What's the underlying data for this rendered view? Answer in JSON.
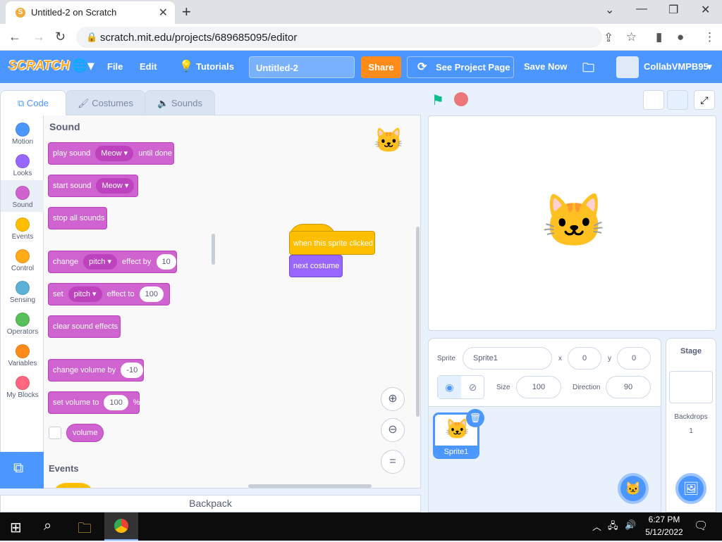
{
  "browser": {
    "tab_title": "Untitled-2 on Scratch",
    "url": "scratch.mit.edu/projects/689685095/editor"
  },
  "menu": {
    "logo": "SCRATCH",
    "file": "File",
    "edit": "Edit",
    "tutorials": "Tutorials",
    "project_title": "Untitled-2",
    "share": "Share",
    "see_project": "See Project Page",
    "save_now": "Save Now",
    "username": "CollabVMPB95"
  },
  "tabs": {
    "code": "Code",
    "costumes": "Costumes",
    "sounds": "Sounds"
  },
  "categories": [
    {
      "label": "Motion",
      "color": "#4c97ff"
    },
    {
      "label": "Looks",
      "color": "#9966ff"
    },
    {
      "label": "Sound",
      "color": "#cf63cf"
    },
    {
      "label": "Events",
      "color": "#ffbf00"
    },
    {
      "label": "Control",
      "color": "#ffab19"
    },
    {
      "label": "Sensing",
      "color": "#5cb1d6"
    },
    {
      "label": "Operators",
      "color": "#59c059"
    },
    {
      "label": "Variables",
      "color": "#ff8c1a"
    },
    {
      "label": "My Blocks",
      "color": "#ff6680"
    }
  ],
  "palette": {
    "section_sound": "Sound",
    "play_sound": "play sound",
    "meow": "Meow",
    "until_done": "until done",
    "start_sound": "start sound",
    "stop_all_sounds": "stop all sounds",
    "change": "change",
    "pitch": "pitch",
    "effect_by": "effect by",
    "val_10": "10",
    "set": "set",
    "effect_to": "effect to",
    "val_100": "100",
    "clear_sound_effects": "clear sound effects",
    "change_volume_by": "change volume by",
    "val_neg10": "-10",
    "set_volume_to": "set volume to",
    "percent": "%",
    "volume": "volume",
    "section_events": "Events"
  },
  "script": {
    "hat": "when this sprite clicked",
    "next_costume": "next costume"
  },
  "backpack": "Backpack",
  "sprite_info": {
    "sprite_label": "Sprite",
    "sprite_name": "Sprite1",
    "x_label": "x",
    "x_value": "0",
    "y_label": "y",
    "y_value": "0",
    "size_label": "Size",
    "size_value": "100",
    "direction_label": "Direction",
    "direction_value": "90"
  },
  "sprites": [
    {
      "name": "Sprite1"
    }
  ],
  "stage_panel": {
    "title": "Stage",
    "backdrops_label": "Backdrops",
    "backdrops_count": "1"
  },
  "taskbar": {
    "time": "6:27 PM",
    "date": "5/12/2022"
  }
}
